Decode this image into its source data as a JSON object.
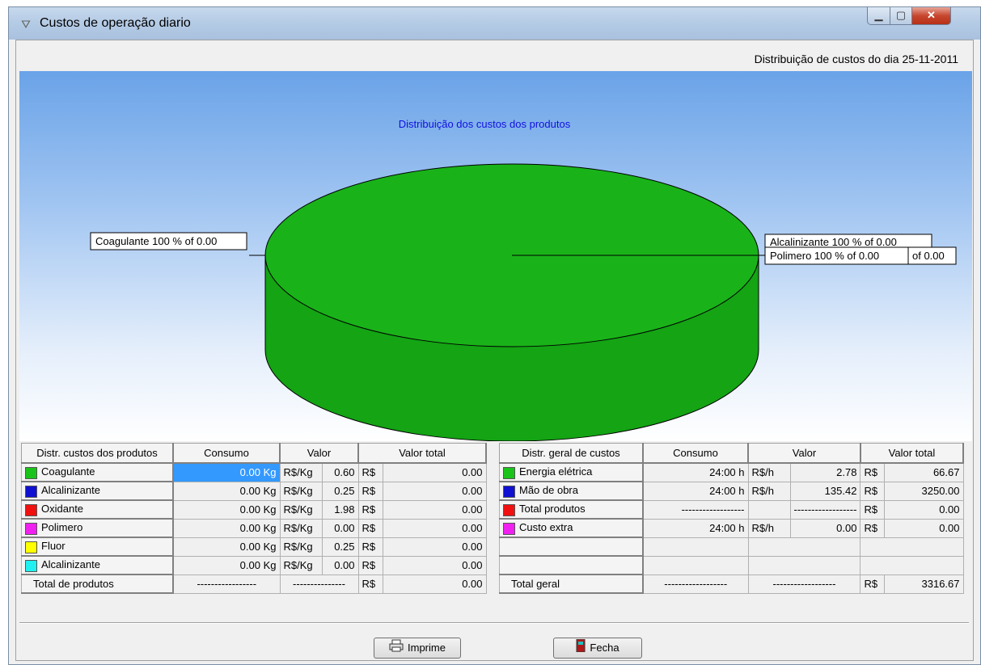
{
  "window": {
    "title": "Custos de operação diario"
  },
  "caption": "Distribuição de custos do dia 25-11-2011",
  "chart_data": {
    "type": "pie",
    "title": "Distribuição dos custos dos produtos",
    "slices": [
      {
        "label": "Coagulante",
        "value": 100,
        "color": "#19b319"
      }
    ],
    "labels": {
      "left": "Coagulante 100 % of 0.00",
      "right1": "Alcalinizante 100 % of 0.00",
      "right2": "Polimero 100 % of 0.00",
      "right3": "of 0.00"
    }
  },
  "products_table": {
    "headers": [
      "Distr. custos dos produtos",
      "Consumo",
      "Valor",
      "Valor total"
    ],
    "rows": [
      {
        "name": "Coagulante",
        "color": "#19c319",
        "consumo": "0.00 Kg",
        "unit": "R$/Kg",
        "valor": "0.60",
        "cur": "R$",
        "total": "0.00"
      },
      {
        "name": "Alcalinizante",
        "color": "#1010d0",
        "consumo": "0.00 Kg",
        "unit": "R$/Kg",
        "valor": "0.25",
        "cur": "R$",
        "total": "0.00"
      },
      {
        "name": "Oxidante",
        "color": "#f01010",
        "consumo": "0.00 Kg",
        "unit": "R$/Kg",
        "valor": "1.98",
        "cur": "R$",
        "total": "0.00"
      },
      {
        "name": "Polimero",
        "color": "#f020f0",
        "consumo": "0.00 Kg",
        "unit": "R$/Kg",
        "valor": "0.00",
        "cur": "R$",
        "total": "0.00"
      },
      {
        "name": "Fluor",
        "color": "#ffff00",
        "consumo": "0.00 Kg",
        "unit": "R$/Kg",
        "valor": "0.25",
        "cur": "R$",
        "total": "0.00"
      },
      {
        "name": "Alcalinizante",
        "color": "#20f0f0",
        "consumo": "0.00 Kg",
        "unit": "R$/Kg",
        "valor": "0.00",
        "cur": "R$",
        "total": "0.00"
      }
    ],
    "total": {
      "label": "Total de produtos",
      "consumo": "-----------------",
      "valor": "---------------",
      "cur": "R$",
      "total": "0.00"
    }
  },
  "general_table": {
    "headers": [
      "Distr. geral de custos",
      "Consumo",
      "Valor",
      "Valor total"
    ],
    "rows": [
      {
        "name": "Energia elétrica",
        "color": "#19c319",
        "consumo": "24:00 h",
        "unit": "R$/h",
        "valor": "2.78",
        "cur": "R$",
        "total": "66.67"
      },
      {
        "name": "Mão de obra",
        "color": "#1010d0",
        "consumo": "24:00 h",
        "unit": "R$/h",
        "valor": "135.42",
        "cur": "R$",
        "total": "3250.00"
      },
      {
        "name": "Total produtos",
        "color": "#f01010",
        "consumo": "------------------",
        "unit": "",
        "valor": "------------------",
        "cur": "R$",
        "total": "0.00"
      },
      {
        "name": "Custo extra",
        "color": "#f020f0",
        "consumo": "24:00 h",
        "unit": "R$/h",
        "valor": "0.00",
        "cur": "R$",
        "total": "0.00"
      }
    ],
    "total": {
      "label": "Total geral",
      "consumo": "------------------",
      "valor": "------------------",
      "cur": "R$",
      "total": "3316.67"
    }
  },
  "buttons": {
    "print": "Imprime",
    "close": "Fecha"
  }
}
